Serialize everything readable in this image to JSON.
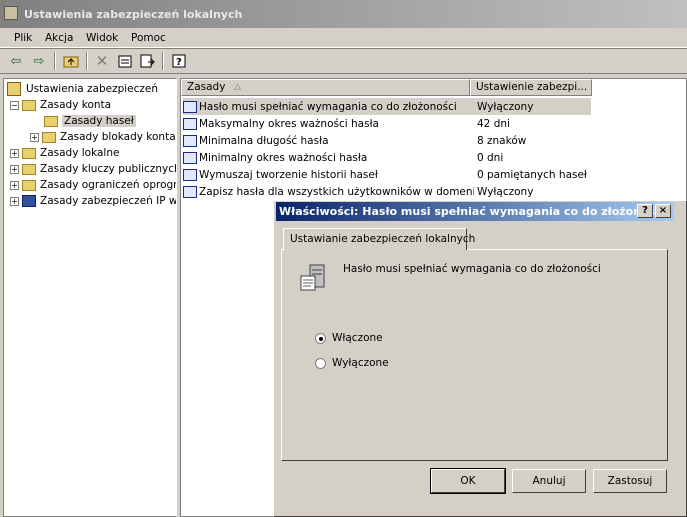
{
  "window": {
    "title": "Ustawienia zabezpieczeń lokalnych"
  },
  "menu": [
    "Plik",
    "Akcja",
    "Widok",
    "Pomoc"
  ],
  "toolbar": {
    "icons": [
      "back-icon",
      "forward-icon",
      "up-folder-icon",
      "delete-icon",
      "properties-icon",
      "export-icon",
      "help-icon"
    ]
  },
  "tree": {
    "root": "Ustawienia zabezpieczeń",
    "items": [
      {
        "label": "Zasady konta",
        "expanded": true
      },
      {
        "label": "Zasady haseł",
        "selected": true
      },
      {
        "label": "Zasady blokady konta"
      },
      {
        "label": "Zasady lokalne"
      },
      {
        "label": "Zasady kluczy publicznych"
      },
      {
        "label": "Zasady ograniczeń oprogra"
      },
      {
        "label": "Zasady zabezpieczeń IP w"
      }
    ]
  },
  "list": {
    "columns": [
      "Zasady",
      "Ustawienie zabezpi..."
    ],
    "rows": [
      {
        "name": "Hasło musi spełniać wymagania co do złożoności",
        "value": "Wyłączony"
      },
      {
        "name": "Maksymalny okres ważności hasła",
        "value": "42 dni"
      },
      {
        "name": "Minimalna długość hasła",
        "value": "8 znaków"
      },
      {
        "name": "Minimalny okres ważności hasła",
        "value": "0 dni"
      },
      {
        "name": "Wymuszaj tworzenie historii haseł",
        "value": "0 pamiętanych haseł"
      },
      {
        "name": "Zapisz hasła dla wszystkich użytkowników w domenie...",
        "value": "Wyłączony"
      }
    ]
  },
  "dialog": {
    "title": "Właściwości: Hasło musi spełniać wymagania co do złożoności",
    "help_btn": "?",
    "close_btn": "×",
    "tab": "Ustawianie zabezpieczeń lokalnych",
    "policy_name": "Hasło musi spełniać wymagania co do złożoności",
    "options": [
      {
        "label": "Włączone",
        "selected": true
      },
      {
        "label": "Wyłączone",
        "selected": false
      }
    ],
    "buttons": {
      "ok": "OK",
      "cancel": "Anuluj",
      "apply": "Zastosuj"
    }
  }
}
